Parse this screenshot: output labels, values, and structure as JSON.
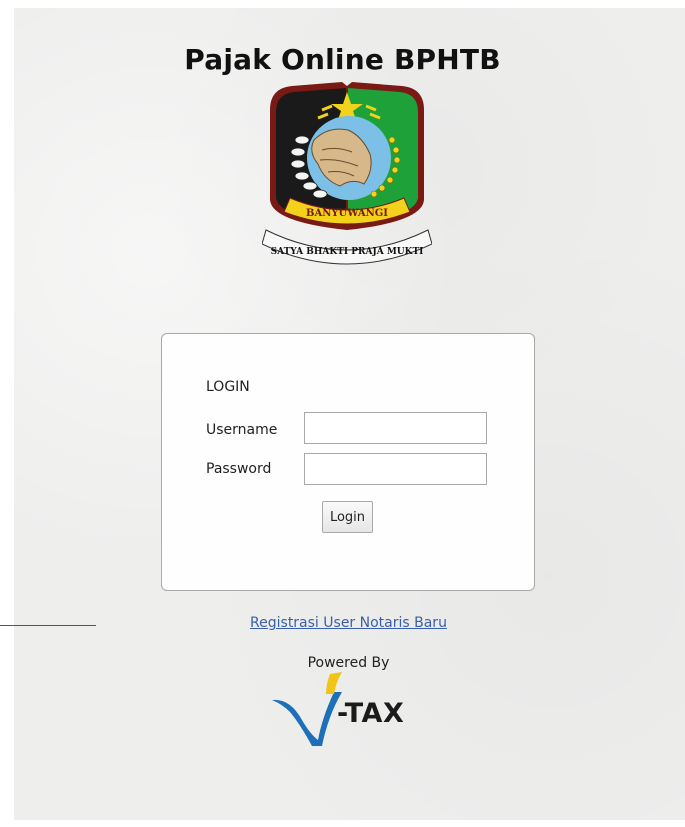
{
  "header": {
    "title": "Pajak Online BPHTB"
  },
  "emblem": {
    "ribbon_text": "BANYUWANGI",
    "motto": "SATYA BHAKTI PRAJA MUKTI",
    "colors": {
      "left": "#1a1a1a",
      "right": "#1fa13a",
      "border": "#7a1a14",
      "ribbon": "#f2d21a",
      "map": "#d6b88a",
      "sea": "#7cc0e8"
    }
  },
  "login_form": {
    "heading": "LOGIN",
    "username_label": "Username",
    "username_value": "",
    "password_label": "Password",
    "password_value": "",
    "submit_label": "Login"
  },
  "footer": {
    "register_link": "Registrasi User Notaris Baru",
    "powered_by": "Powered By",
    "brand_text": "-TAX",
    "brand_colors": {
      "v_blue": "#1d6fb8",
      "v_yellow": "#f0c419"
    }
  }
}
